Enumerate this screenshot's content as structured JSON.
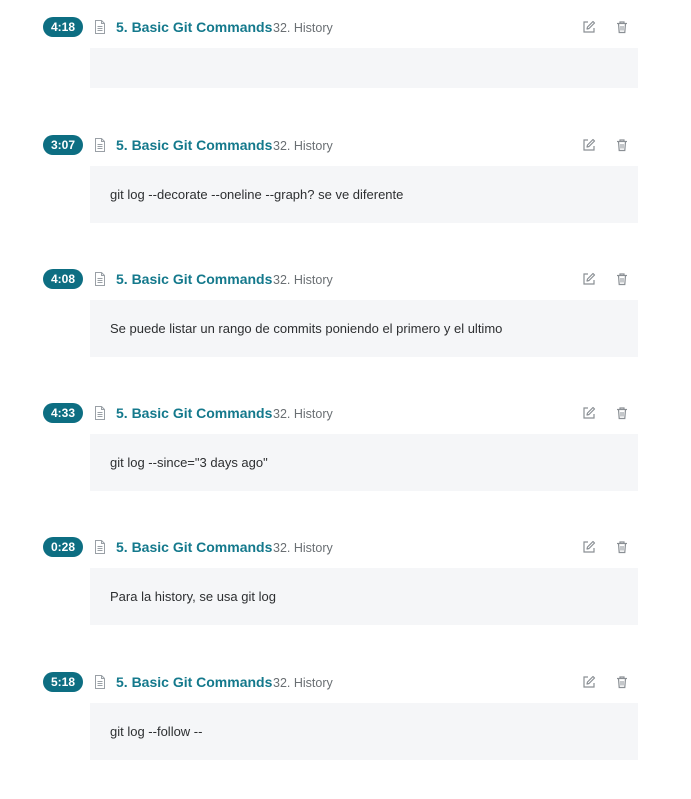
{
  "notes": [
    {
      "timestamp": "4:18",
      "section": "5. Basic Git Commands",
      "lecture": "32. History",
      "content": ""
    },
    {
      "timestamp": "3:07",
      "section": "5. Basic Git Commands",
      "lecture": "32. History",
      "content": "git log --decorate --oneline --graph? se ve diferente"
    },
    {
      "timestamp": "4:08",
      "section": "5. Basic Git Commands",
      "lecture": "32. History",
      "content": "Se puede listar un rango de commits poniendo el primero y el ultimo"
    },
    {
      "timestamp": "4:33",
      "section": "5. Basic Git Commands",
      "lecture": "32. History",
      "content": "git log --since=\"3 days ago\""
    },
    {
      "timestamp": "0:28",
      "section": "5. Basic Git Commands",
      "lecture": "32. History",
      "content": "Para la history, se usa git log"
    },
    {
      "timestamp": "5:18",
      "section": "5. Basic Git Commands",
      "lecture": "32. History",
      "content": "git log --follow --"
    }
  ],
  "icons": {
    "document": "document-icon",
    "edit": "edit-icon",
    "delete": "trash-icon"
  },
  "colors": {
    "timestamp_bg": "#0d6e82",
    "section_link": "#14798c",
    "note_bg": "#f5f6f8"
  }
}
